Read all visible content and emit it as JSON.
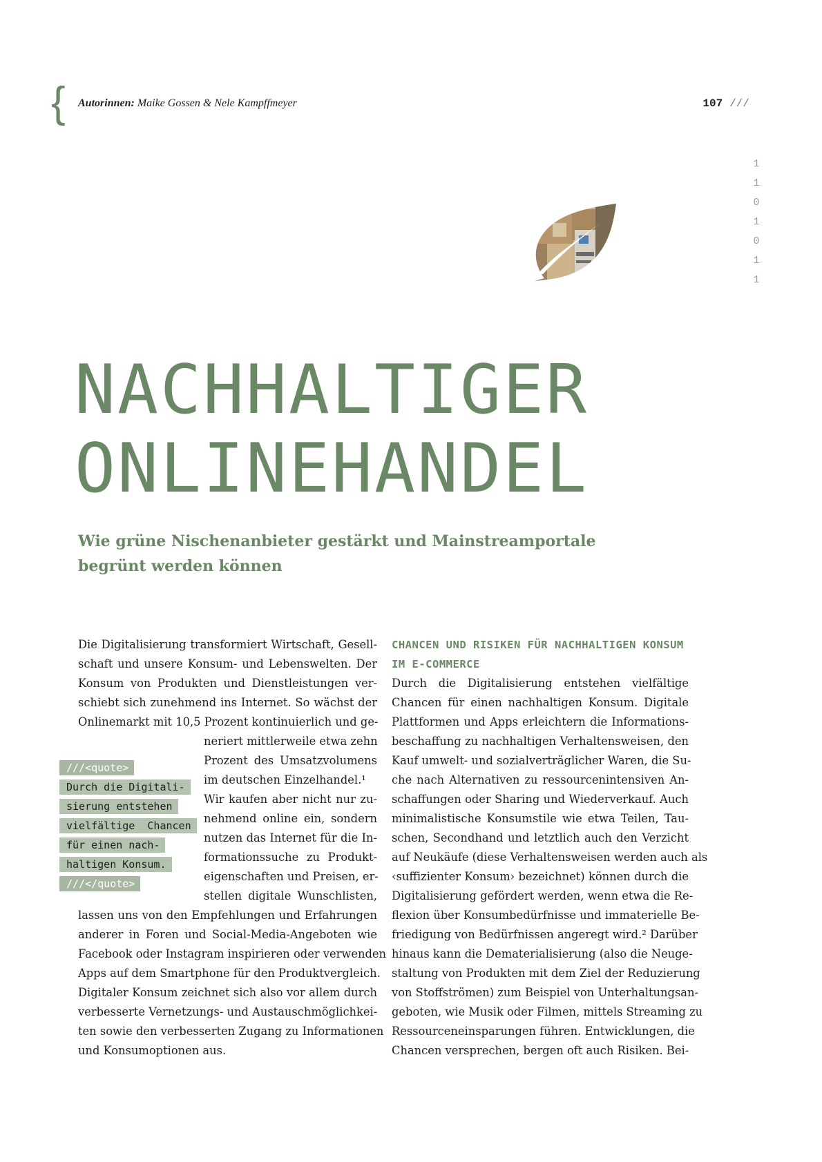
{
  "header": {
    "brace": "{",
    "authors_label": "Autorinnen:",
    "authors_names": "Maike Gossen & Nele Kampffmeyer",
    "page_number": "107",
    "page_slashes": "///"
  },
  "binary_digits": [
    "1",
    "1",
    "0",
    "1",
    "0",
    "1",
    "1"
  ],
  "title_lines": [
    "NACHHALTIGER",
    "ONLINEHANDEL"
  ],
  "subtitle_lines": [
    "Wie grüne Nischenanbieter gestärkt und Mainstreamportale",
    "begrünt werden können"
  ],
  "left_column_lines": [
    "Die Digitalisierung transformiert Wirtschaft, Gesell-",
    "schaft und unsere Konsum- und Lebenswelten. Der",
    "Konsum von Produkten und Dienstleistungen ver-",
    "schiebt sich zunehmend ins Internet. So wächst der",
    "Onlinemarkt mit 10,5 Prozent kontinuierlich und ge-",
    "neriert mittlerweile etwa zehn",
    "Prozent des Umsatzvolumens",
    "im deutschen Einzelhandel.¹",
    "Wir kaufen aber nicht nur zu-",
    "nehmend online ein, sondern",
    "nutzen das Internet für die In-",
    "formationssuche zu Produkt-",
    "eigenschaften und Preisen, er-",
    "stellen digitale Wunschlisten,",
    "lassen uns von den Empfehlungen und Erfahrungen",
    "anderer in Foren und Social-Media-Angeboten wie",
    "Facebook oder Instagram inspirieren oder verwenden",
    "Apps auf dem Smartphone für den Produktvergleich.",
    "Digitaler Konsum zeichnet sich also vor allem durch",
    "verbesserte Vernetzungs- und Austauschmöglichkei-",
    "ten sowie den verbesserten Zugang zu Informationen",
    "und Konsumoptionen aus."
  ],
  "pull_quote": {
    "open_tag": "///<quote>",
    "lines": [
      "Durch die Digitali-",
      "sierung entstehen",
      "vielfältige  Chancen",
      "für einen nach-",
      "haltigen Konsum."
    ],
    "close_tag": "///</quote>"
  },
  "right_column": {
    "heading_lines": [
      "CHANCEN UND RISIKEN FÜR NACHHALTIGEN KONSUM",
      "IM E-COMMERCE"
    ],
    "lines": [
      "Durch die Digitalisierung entstehen vielfältige",
      "Chancen für einen nachhaltigen Konsum. Digitale",
      "Plattformen und Apps erleichtern die Informations-",
      "beschaffung zu nachhaltigen Verhaltensweisen, den",
      "Kauf umwelt- und sozialverträglicher Waren, die Su-",
      "che nach Alternativen zu ressourcenintensiven An-",
      "schaffungen oder Sharing und Wiederverkauf. Auch",
      "minimalistische Konsumstile wie etwa Teilen, Tau-",
      "schen, Secondhand und letztlich auch den Verzicht",
      "auf Neukäufe (diese Verhaltensweisen werden auch als",
      "‹suffizienter Konsum› bezeichnet) können durch die",
      "Digitalisierung gefördert werden, wenn etwa die Re-",
      "flexion über Konsumbedürfnisse und immaterielle Be-",
      "friedigung von Bedürfnissen angeregt wird.² Darüber",
      "hinaus kann die Dematerialisierung (also die Neuge-",
      "staltung von Produkten mit dem Ziel der Reduzierung",
      "von Stoffströmen) zum Beispiel von Unterhaltungsan-",
      "geboten, wie Musik oder Filmen, mittels Streaming zu",
      "Ressourceneinsparungen führen. Entwicklungen, die",
      "Chancen versprechen, bergen oft auch Risiken. Bei-"
    ]
  },
  "colors": {
    "accent_green": "#6a8766",
    "quote_highlight": "#b4c3b0",
    "text": "#1e1e1e"
  },
  "icons": [
    "leaf-photo-icon"
  ]
}
